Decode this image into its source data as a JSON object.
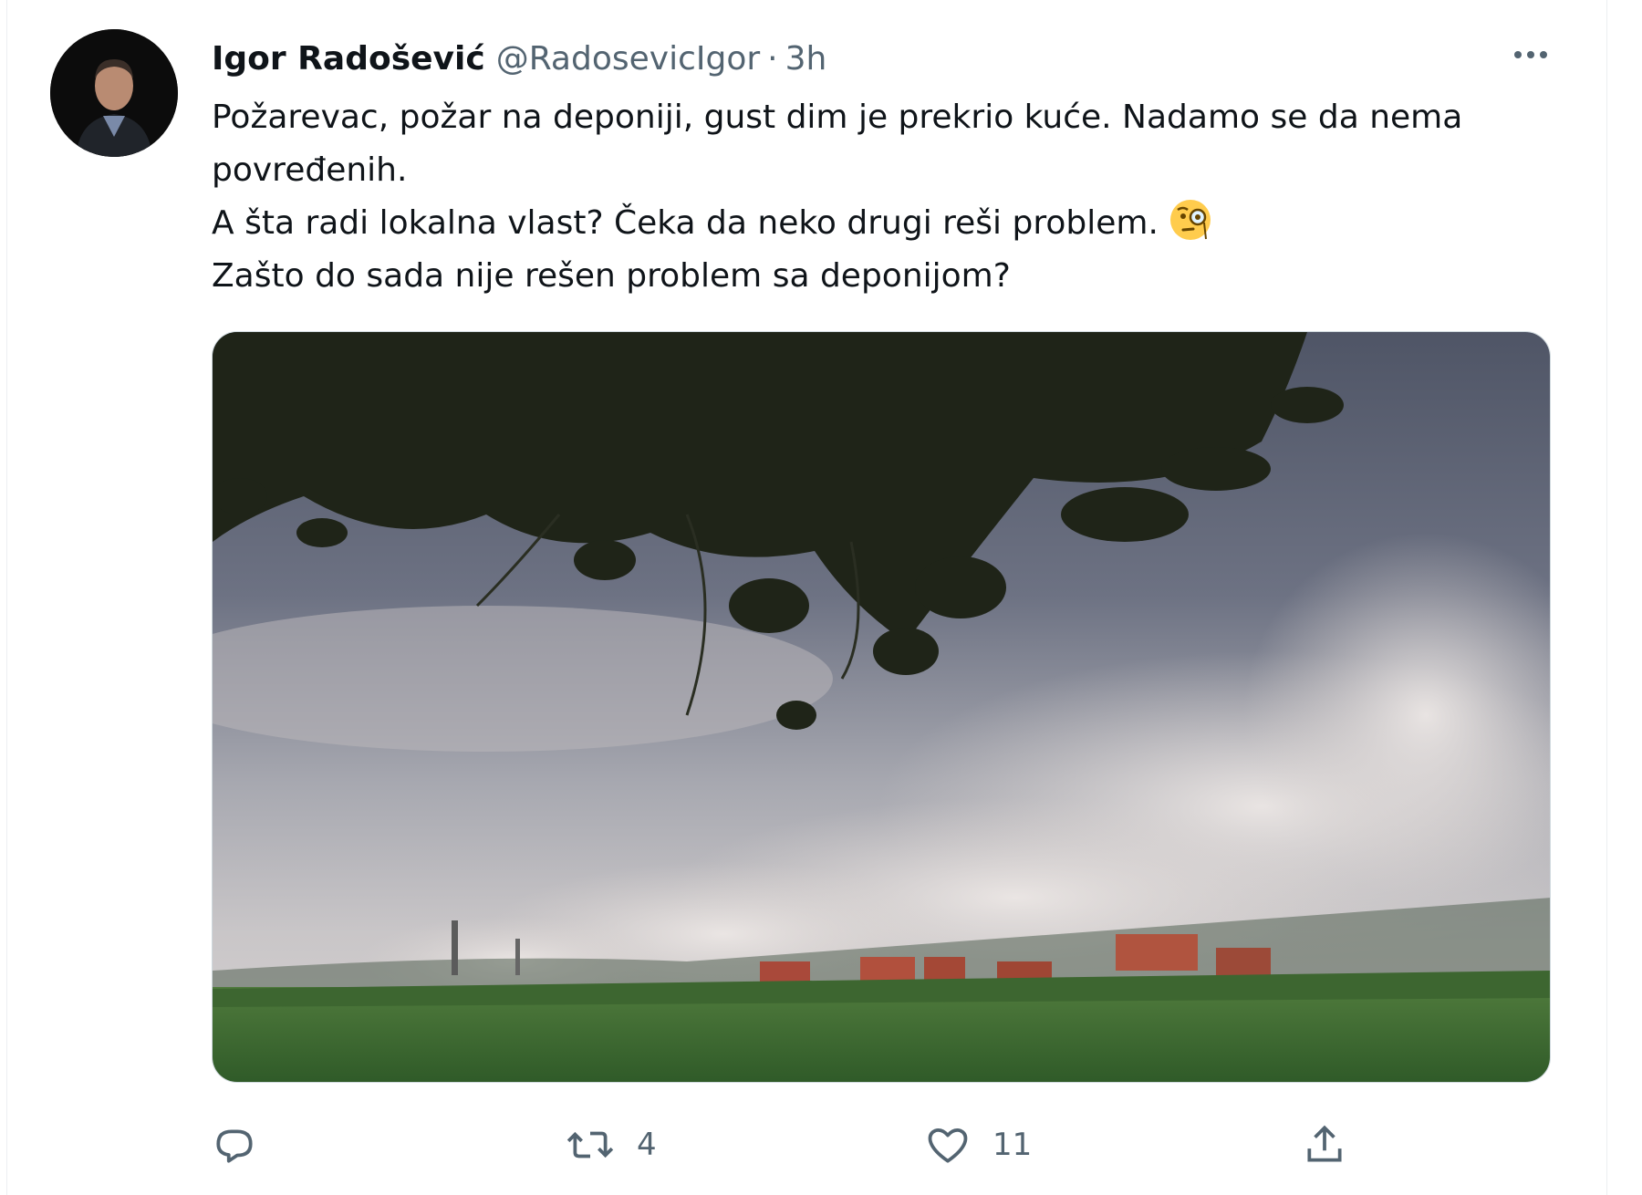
{
  "tweet": {
    "author_name": "Igor Radošević",
    "handle": "@RadosevicIgor",
    "separator": "·",
    "time": "3h",
    "text_lines": [
      "Požarevac, požar na deponiji, gust dim je prekrio kuće. Nadamo se da nema povređenih.",
      "A šta radi lokalna vlast? Čeka da neko drugi reši problem.",
      "Zašto do sada nije rešen problem sa deponijom?"
    ],
    "emoji": "face-with-monocle-icon"
  },
  "actions": {
    "reply_count": "",
    "retweet_count": "4",
    "like_count": "11"
  },
  "colors": {
    "text": "#0f1419",
    "secondary": "#536471",
    "border": "#cfd9de"
  }
}
